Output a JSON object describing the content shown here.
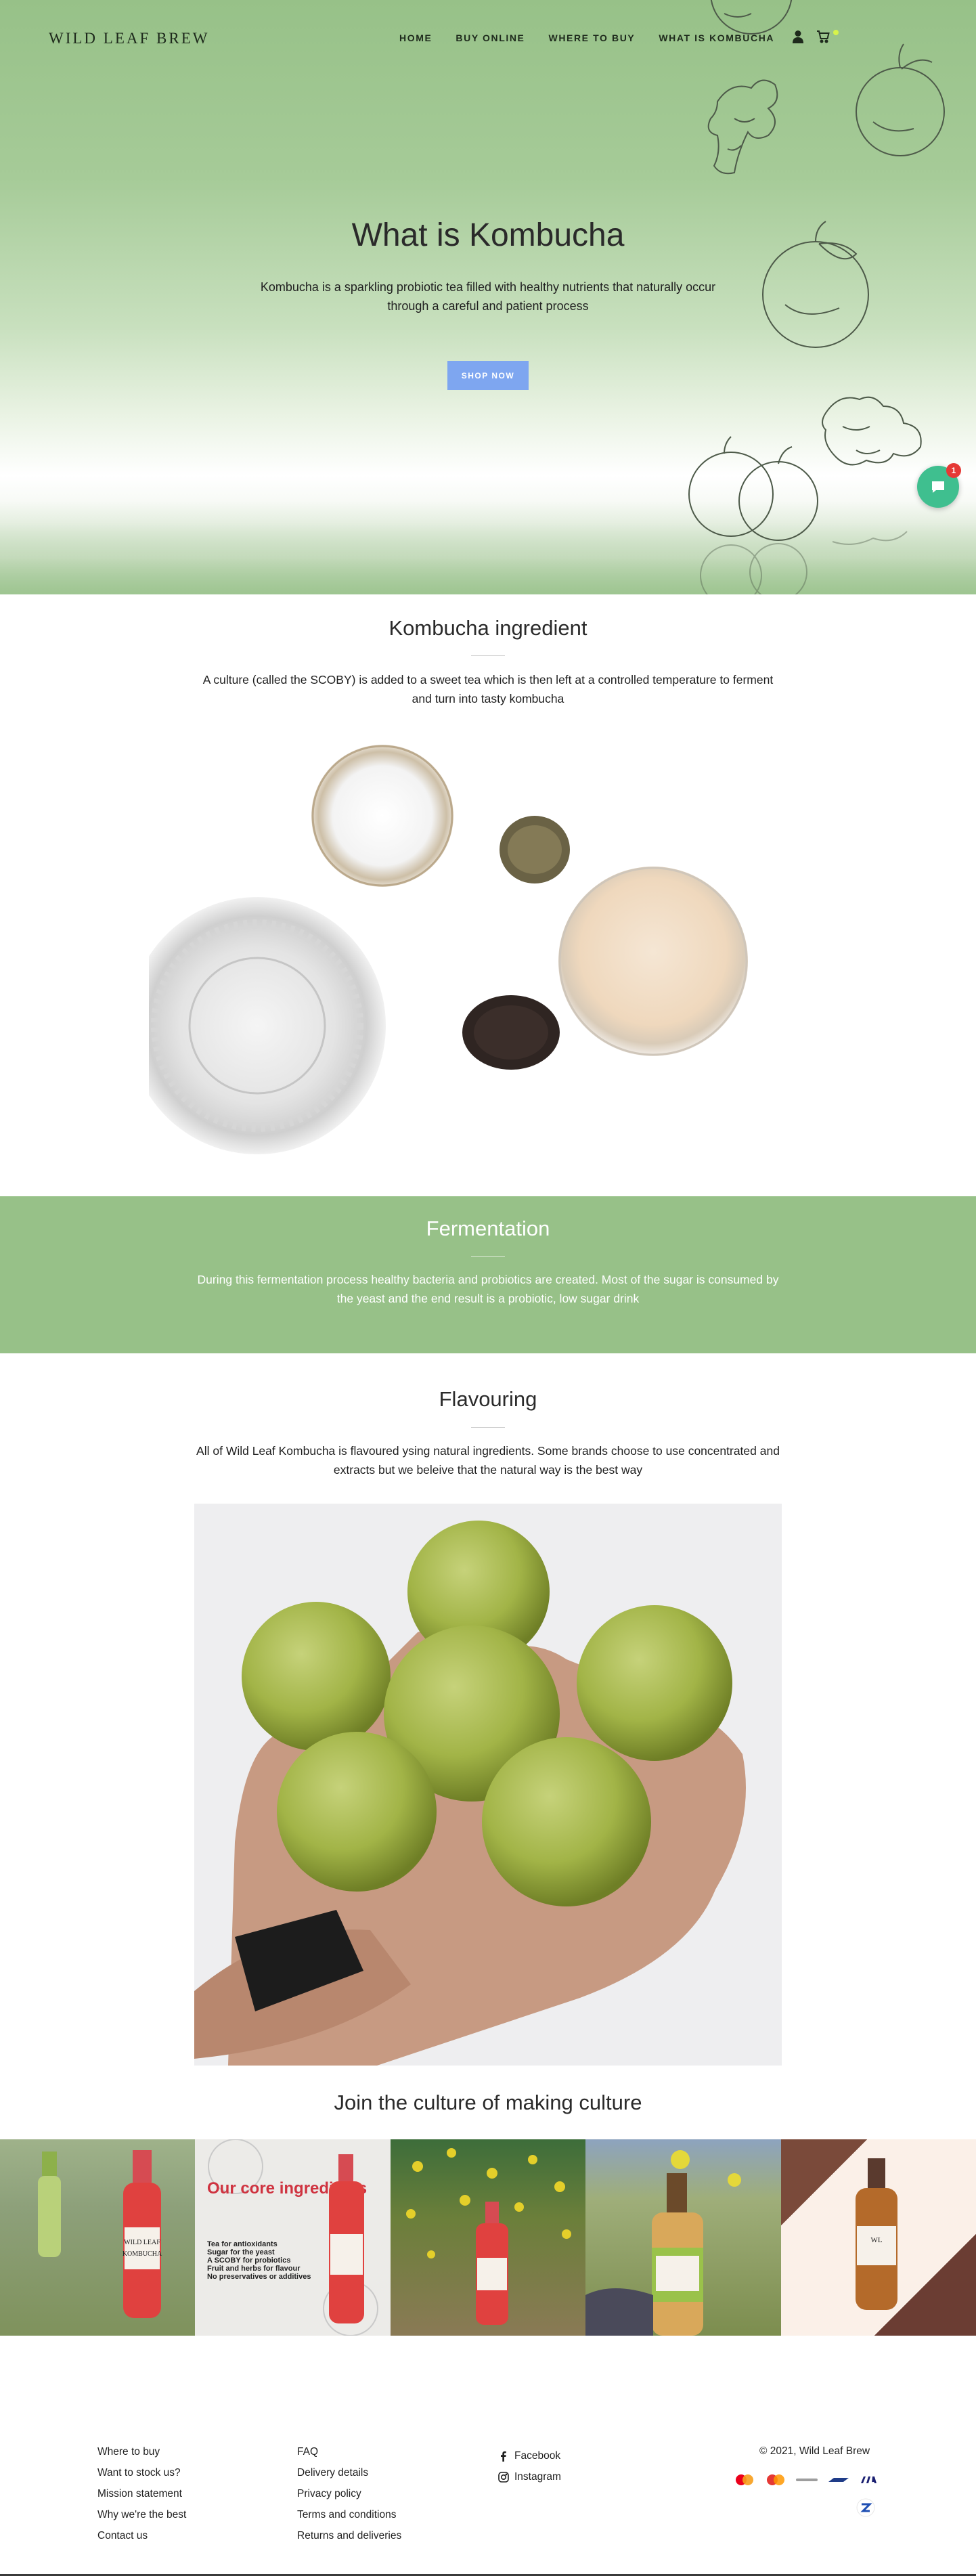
{
  "header": {
    "logo": "WILD LEAF BREW",
    "nav": [
      "HOME",
      "BUY ONLINE",
      "WHERE TO BUY",
      "WHAT IS KOMBUCHA"
    ],
    "icons": [
      "account-icon",
      "cart-icon"
    ]
  },
  "hero": {
    "title": "What is Kombucha",
    "subtitle": "Kombucha is a sparkling probiotic tea filled with healthy nutrients that naturally occur through a careful and patient process",
    "button": "SHOP NOW"
  },
  "chat": {
    "badge": "1",
    "icon": "chat-icon"
  },
  "ingredient": {
    "title": "Kombucha ingredient",
    "text": "A culture (called the SCOBY) is added to a sweet tea which is then left at a controlled temperature to ferment and turn into tasty kombucha"
  },
  "fermentation": {
    "title": "Fermentation",
    "text": "During this fermentation process healthy bacteria and probiotics are created. Most of the sugar is consumed by the yeast and the end result is a probiotic, low sugar drink"
  },
  "flavouring": {
    "title": "Flavouring",
    "text": "All of Wild Leaf Kombucha is flavoured ysing natural ingredients. Some brands choose to use concentrated and extracts but we beleive that the natural way is the best way"
  },
  "gallery": {
    "title": "Join the culture of making culture",
    "core_heading": "Our core ingredients",
    "core_list": [
      "Tea for antioxidants",
      "Sugar for the yeast",
      "A SCOBY for probiotics",
      "Fruit and herbs for flavour",
      "No preservatives or additives"
    ],
    "bottle_brand": "WILD LEAF",
    "bottle_name": "KOMBUCHA",
    "bottle_mark": "WL"
  },
  "footer": {
    "col1": [
      "Where to buy",
      "Want to stock us?",
      "Mission statement",
      "Why we're the best",
      "Contact us"
    ],
    "col2": [
      "FAQ",
      "Delivery details",
      "Privacy policy",
      "Terms and conditions",
      "Returns and deliveries"
    ],
    "social": [
      "Facebook",
      "Instagram"
    ],
    "copyright": "© 2021, Wild Leaf Brew",
    "payments": [
      "mastercard-icon",
      "maestro-icon",
      "masterpass-icon",
      "eft-icon",
      "visa-icon",
      "zapper-icon"
    ]
  },
  "colors": {
    "hero_green": "#97c188",
    "band_green": "#97c188",
    "button_blue": "#7ea6f0",
    "chat_green": "#3fbf8f",
    "badge_red": "#e53935",
    "bottle_red": "#e0413f"
  }
}
